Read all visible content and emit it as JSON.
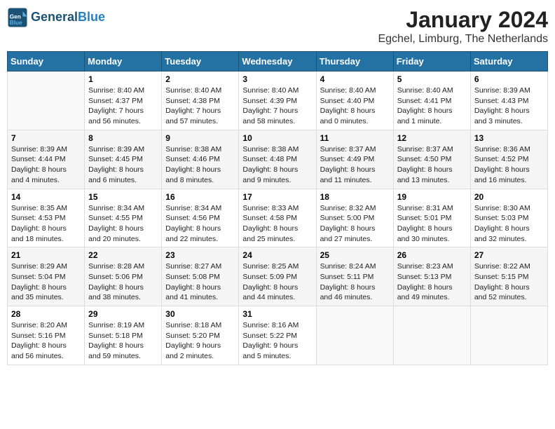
{
  "header": {
    "logo_line1": "General",
    "logo_line2": "Blue",
    "title": "January 2024",
    "subtitle": "Egchel, Limburg, The Netherlands"
  },
  "days_of_week": [
    "Sunday",
    "Monday",
    "Tuesday",
    "Wednesday",
    "Thursday",
    "Friday",
    "Saturday"
  ],
  "weeks": [
    [
      {
        "day": "",
        "info": ""
      },
      {
        "day": "1",
        "info": "Sunrise: 8:40 AM\nSunset: 4:37 PM\nDaylight: 7 hours\nand 56 minutes."
      },
      {
        "day": "2",
        "info": "Sunrise: 8:40 AM\nSunset: 4:38 PM\nDaylight: 7 hours\nand 57 minutes."
      },
      {
        "day": "3",
        "info": "Sunrise: 8:40 AM\nSunset: 4:39 PM\nDaylight: 7 hours\nand 58 minutes."
      },
      {
        "day": "4",
        "info": "Sunrise: 8:40 AM\nSunset: 4:40 PM\nDaylight: 8 hours\nand 0 minutes."
      },
      {
        "day": "5",
        "info": "Sunrise: 8:40 AM\nSunset: 4:41 PM\nDaylight: 8 hours\nand 1 minute."
      },
      {
        "day": "6",
        "info": "Sunrise: 8:39 AM\nSunset: 4:43 PM\nDaylight: 8 hours\nand 3 minutes."
      }
    ],
    [
      {
        "day": "7",
        "info": "Sunrise: 8:39 AM\nSunset: 4:44 PM\nDaylight: 8 hours\nand 4 minutes."
      },
      {
        "day": "8",
        "info": "Sunrise: 8:39 AM\nSunset: 4:45 PM\nDaylight: 8 hours\nand 6 minutes."
      },
      {
        "day": "9",
        "info": "Sunrise: 8:38 AM\nSunset: 4:46 PM\nDaylight: 8 hours\nand 8 minutes."
      },
      {
        "day": "10",
        "info": "Sunrise: 8:38 AM\nSunset: 4:48 PM\nDaylight: 8 hours\nand 9 minutes."
      },
      {
        "day": "11",
        "info": "Sunrise: 8:37 AM\nSunset: 4:49 PM\nDaylight: 8 hours\nand 11 minutes."
      },
      {
        "day": "12",
        "info": "Sunrise: 8:37 AM\nSunset: 4:50 PM\nDaylight: 8 hours\nand 13 minutes."
      },
      {
        "day": "13",
        "info": "Sunrise: 8:36 AM\nSunset: 4:52 PM\nDaylight: 8 hours\nand 16 minutes."
      }
    ],
    [
      {
        "day": "14",
        "info": "Sunrise: 8:35 AM\nSunset: 4:53 PM\nDaylight: 8 hours\nand 18 minutes."
      },
      {
        "day": "15",
        "info": "Sunrise: 8:34 AM\nSunset: 4:55 PM\nDaylight: 8 hours\nand 20 minutes."
      },
      {
        "day": "16",
        "info": "Sunrise: 8:34 AM\nSunset: 4:56 PM\nDaylight: 8 hours\nand 22 minutes."
      },
      {
        "day": "17",
        "info": "Sunrise: 8:33 AM\nSunset: 4:58 PM\nDaylight: 8 hours\nand 25 minutes."
      },
      {
        "day": "18",
        "info": "Sunrise: 8:32 AM\nSunset: 5:00 PM\nDaylight: 8 hours\nand 27 minutes."
      },
      {
        "day": "19",
        "info": "Sunrise: 8:31 AM\nSunset: 5:01 PM\nDaylight: 8 hours\nand 30 minutes."
      },
      {
        "day": "20",
        "info": "Sunrise: 8:30 AM\nSunset: 5:03 PM\nDaylight: 8 hours\nand 32 minutes."
      }
    ],
    [
      {
        "day": "21",
        "info": "Sunrise: 8:29 AM\nSunset: 5:04 PM\nDaylight: 8 hours\nand 35 minutes."
      },
      {
        "day": "22",
        "info": "Sunrise: 8:28 AM\nSunset: 5:06 PM\nDaylight: 8 hours\nand 38 minutes."
      },
      {
        "day": "23",
        "info": "Sunrise: 8:27 AM\nSunset: 5:08 PM\nDaylight: 8 hours\nand 41 minutes."
      },
      {
        "day": "24",
        "info": "Sunrise: 8:25 AM\nSunset: 5:09 PM\nDaylight: 8 hours\nand 44 minutes."
      },
      {
        "day": "25",
        "info": "Sunrise: 8:24 AM\nSunset: 5:11 PM\nDaylight: 8 hours\nand 46 minutes."
      },
      {
        "day": "26",
        "info": "Sunrise: 8:23 AM\nSunset: 5:13 PM\nDaylight: 8 hours\nand 49 minutes."
      },
      {
        "day": "27",
        "info": "Sunrise: 8:22 AM\nSunset: 5:15 PM\nDaylight: 8 hours\nand 52 minutes."
      }
    ],
    [
      {
        "day": "28",
        "info": "Sunrise: 8:20 AM\nSunset: 5:16 PM\nDaylight: 8 hours\nand 56 minutes."
      },
      {
        "day": "29",
        "info": "Sunrise: 8:19 AM\nSunset: 5:18 PM\nDaylight: 8 hours\nand 59 minutes."
      },
      {
        "day": "30",
        "info": "Sunrise: 8:18 AM\nSunset: 5:20 PM\nDaylight: 9 hours\nand 2 minutes."
      },
      {
        "day": "31",
        "info": "Sunrise: 8:16 AM\nSunset: 5:22 PM\nDaylight: 9 hours\nand 5 minutes."
      },
      {
        "day": "",
        "info": ""
      },
      {
        "day": "",
        "info": ""
      },
      {
        "day": "",
        "info": ""
      }
    ]
  ]
}
